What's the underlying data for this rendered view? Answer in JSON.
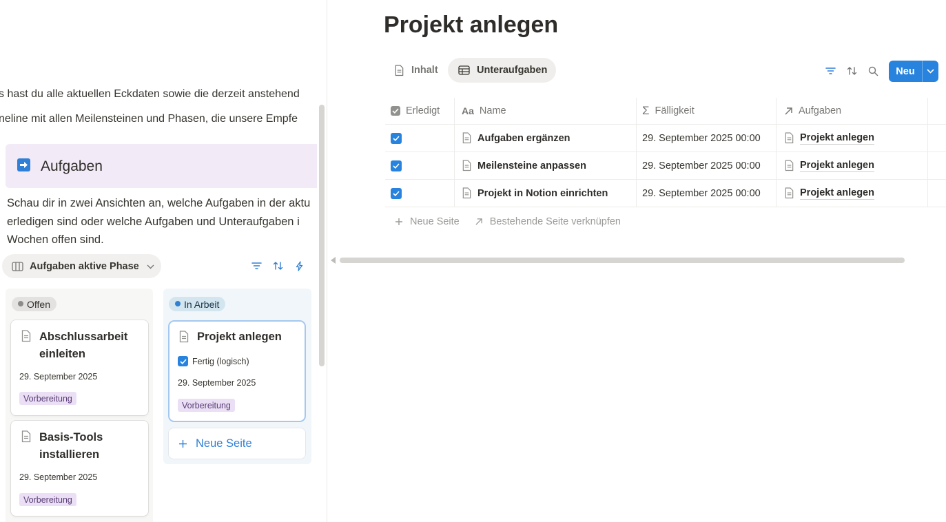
{
  "left": {
    "intro_lines": [
      "s hast du alle aktuellen Eckdaten sowie die derzeit anstehend",
      "neline mit allen Meilensteinen und Phasen, die unsere Empfe"
    ],
    "callout_title": "Aufgaben",
    "desc_lines": [
      "Schau dir in zwei Ansichten an, welche Aufgaben in der aktu",
      "erledigen sind oder welche Aufgaben und Unteraufgaben i",
      "Wochen offen sind."
    ],
    "view_name": "Aufgaben aktive Phase",
    "columns": [
      {
        "status": "Offen",
        "cards": [
          {
            "title_lines": [
              "Abschlussarbeit",
              "einleiten"
            ],
            "date": "29. September 2025",
            "tag": "Vorbereitung"
          },
          {
            "title_lines": [
              "Basis-Tools",
              "installieren"
            ],
            "date": "29. September 2025",
            "tag": "Vorbereitung"
          }
        ]
      },
      {
        "status": "In Arbeit",
        "cards": [
          {
            "title": "Projekt anlegen",
            "check_label": "Fertig (logisch)",
            "date": "29. September 2025",
            "tag": "Vorbereitung"
          }
        ],
        "new_page": "Neue Seite"
      }
    ]
  },
  "right": {
    "title": "Projekt anlegen",
    "tabs": [
      "Inhalt",
      "Unteraufgaben"
    ],
    "active_tab": "Unteraufgaben",
    "new_button": "Neu",
    "table": {
      "headers": [
        "Erledigt",
        "Name",
        "Fälligkeit",
        "Aufgaben"
      ],
      "rows": [
        {
          "done": true,
          "name": "Aufgaben ergänzen",
          "due": "29. September 2025 00:00",
          "relation": "Projekt anlegen"
        },
        {
          "done": true,
          "name": "Meilensteine anpassen",
          "due": "29. September 2025 00:00",
          "relation": "Projekt anlegen"
        },
        {
          "done": true,
          "name": "Projekt in Notion einrichten",
          "due": "29. September 2025 00:00",
          "relation": "Projekt anlegen"
        }
      ]
    },
    "add_new": "Neue Seite",
    "link_existing": "Bestehende Seite verknüpfen"
  },
  "colors": {
    "accent": "#2783de",
    "tag_bg": "#eadff4",
    "callout_bg": "#f2eaf6"
  }
}
